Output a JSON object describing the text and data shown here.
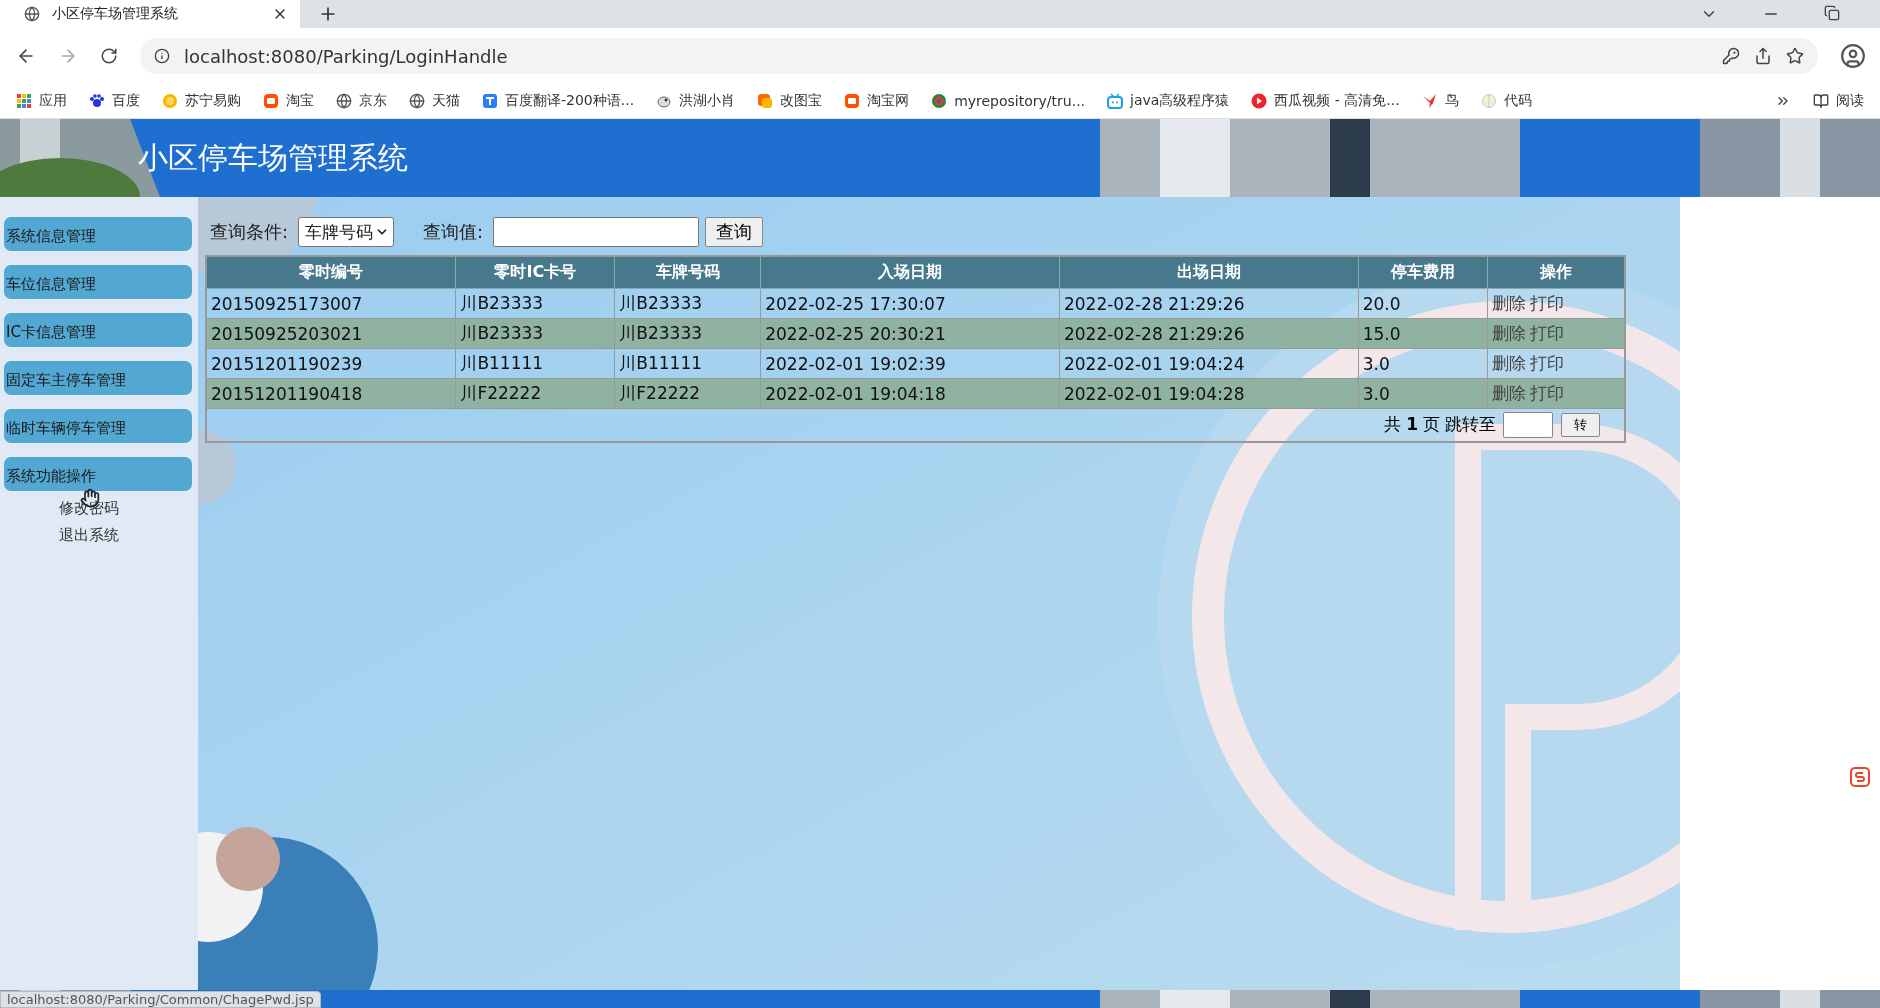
{
  "browser": {
    "tab": {
      "title": "小区停车场管理系统",
      "selected": true
    },
    "url": "localhost:8080/Parking/LoginHandle",
    "bookmarks": [
      {
        "label": "应用",
        "kind": "apps"
      },
      {
        "label": "百度",
        "kind": "paw"
      },
      {
        "label": "苏宁易购",
        "kind": "sun"
      },
      {
        "label": "淘宝",
        "kind": "taobao"
      },
      {
        "label": "京东",
        "kind": "globe"
      },
      {
        "label": "天猫",
        "kind": "globe"
      },
      {
        "label": "百度翻译-200种语...",
        "kind": "translate"
      },
      {
        "label": "洪湖小肖",
        "kind": "bird"
      },
      {
        "label": "改图宝",
        "kind": "tile"
      },
      {
        "label": "淘宝网",
        "kind": "taobao"
      },
      {
        "label": "myrepository/tru...",
        "kind": "swirl"
      },
      {
        "label": "java高级程序猿",
        "kind": "tv"
      },
      {
        "label": "西瓜视频 - 高清免...",
        "kind": "play"
      },
      {
        "label": "鸟",
        "kind": "redbird"
      },
      {
        "label": "代码",
        "kind": "pale"
      }
    ],
    "reading_list": "阅读"
  },
  "header": {
    "title": "小区停车场管理系统"
  },
  "sidebar": {
    "items": [
      {
        "label": "系统信息管理"
      },
      {
        "label": "车位信息管理"
      },
      {
        "label": "IC卡信息管理"
      },
      {
        "label": "固定车主停车管理"
      },
      {
        "label": "临时车辆停车管理"
      },
      {
        "label": "系统功能操作",
        "children": [
          {
            "label": "修改密码"
          },
          {
            "label": "退出系统"
          }
        ]
      }
    ]
  },
  "query": {
    "condition_label": "查询条件:",
    "condition_value": "车牌号码",
    "value_label": "查询值:",
    "button": "查询"
  },
  "table": {
    "columns": [
      "零时编号",
      "零时IC卡号",
      "车牌号码",
      "入场日期",
      "出场日期",
      "停车费用",
      "操作"
    ],
    "rows": [
      {
        "cells": [
          "20150925173007",
          "川B23333",
          "川B23333",
          "2022-02-25 17:30:07",
          "2022-02-28 21:29:26",
          "20.0"
        ],
        "actions": [
          "删除",
          "打印"
        ]
      },
      {
        "cells": [
          "20150925203021",
          "川B23333",
          "川B23333",
          "2022-02-25 20:30:21",
          "2022-02-28 21:29:26",
          "15.0"
        ],
        "actions": [
          "删除",
          "打印"
        ]
      },
      {
        "cells": [
          "20151201190239",
          "川B11111",
          "川B11111",
          "2022-02-01 19:02:39",
          "2022-02-01 19:04:24",
          "3.0"
        ],
        "actions": [
          "删除",
          "打印"
        ]
      },
      {
        "cells": [
          "20151201190418",
          "川F22222",
          "川F22222",
          "2022-02-01 19:04:18",
          "2022-02-01 19:04:28",
          "3.0"
        ],
        "actions": [
          "删除",
          "打印"
        ]
      }
    ],
    "pager": {
      "prefix": "共",
      "total": "1",
      "suffix": "页",
      "jump_label": "跳转至",
      "button": "转"
    }
  },
  "status_bar": "localhost:8080/Parking/Common/ChagePwd.jsp"
}
